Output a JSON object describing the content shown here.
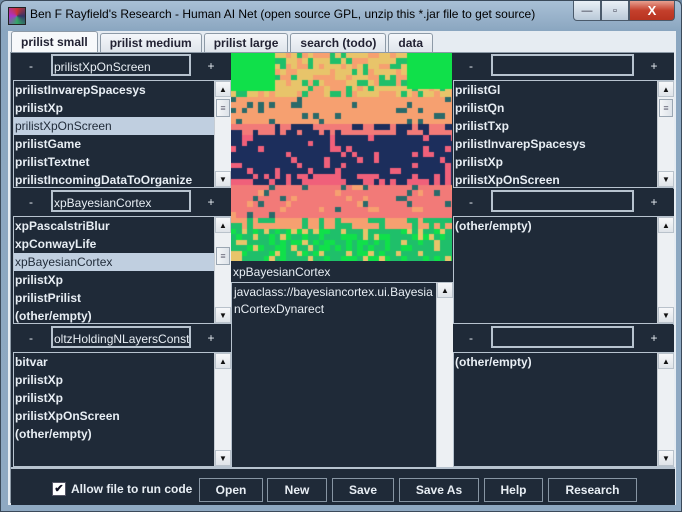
{
  "window": {
    "title": "Ben F Rayfield's Research - Human AI Net (open source GPL, unzip this *.jar file to get source)",
    "controls": {
      "minimize": "—",
      "maximize": "▫",
      "close": "X"
    }
  },
  "tabs": [
    {
      "label": "prilist small",
      "active": true
    },
    {
      "label": "prilist medium",
      "active": false
    },
    {
      "label": "prilist large",
      "active": false
    },
    {
      "label": "search (todo)",
      "active": false
    },
    {
      "label": "data",
      "active": false
    }
  ],
  "panel_buttons": {
    "minus": "-",
    "plus": "+"
  },
  "left_panels": [
    {
      "name": "prilistXpOnScreen",
      "items": [
        "prilistInvarepSpacesys",
        "prilistXp",
        "prilistXpOnScreen",
        "prilistGame",
        "prilistTextnet",
        "prilistIncomingDataToOrganize"
      ],
      "selected": 2
    },
    {
      "name": "xpBayesianCortex",
      "items": [
        "xpPascalstriBlur",
        "xpConwayLife",
        "xpBayesianCortex",
        "prilistXp",
        "prilistPrilist",
        "(other/empty)"
      ],
      "selected": 2
    },
    {
      "name": "oltzHoldingNLayersConst",
      "items": [
        "bitvar",
        "prilistXp",
        "prilistXp",
        "prilistXpOnScreen",
        "(other/empty)"
      ],
      "selected": -1
    }
  ],
  "right_panels": [
    {
      "name": "",
      "items": [
        "prilistGl",
        "prilistQn",
        "prilistTxp",
        "prilistInvarepSpacesys",
        "prilistXp",
        "prilistXpOnScreen"
      ],
      "selected": -1
    },
    {
      "name": "",
      "items": [
        "(other/empty)"
      ],
      "selected": -1
    },
    {
      "name": "",
      "items": [
        "(other/empty)"
      ],
      "selected": -1
    }
  ],
  "center": {
    "label": "xpBayesianCortex",
    "text": "javaclass://bayesiancortex.ui.BayesianCortexDynarect",
    "colors": {
      "green": "#10e04a",
      "mint": "#1fbf6a",
      "yellow": "#e8c46a",
      "peach": "#f6a070",
      "salmon": "#f27a78",
      "pink": "#f0607a",
      "navy": "#1c2e5c",
      "teal": "#2a6a6a"
    }
  },
  "bottom": {
    "checkbox_label": "Allow file to run code",
    "checkbox_checked": true,
    "buttons": [
      "Open",
      "New",
      "Save",
      "Save As",
      "Help",
      "Research"
    ]
  },
  "scroll_icons": {
    "up": "▲",
    "down": "▼",
    "thumb": "≡"
  }
}
